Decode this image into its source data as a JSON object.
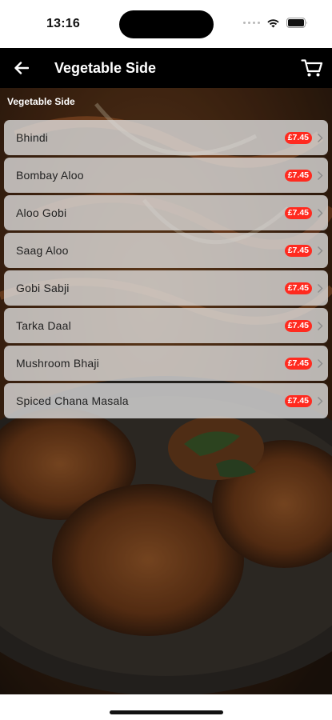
{
  "status_bar": {
    "time": "13:16",
    "icons": [
      "signal-dots-icon",
      "wifi-icon",
      "battery-icon"
    ]
  },
  "nav": {
    "title": "Vegetable Side",
    "back_icon": "arrow-left-icon",
    "cart_icon": "cart-icon"
  },
  "section": {
    "heading": "Vegetable Side"
  },
  "items": [
    {
      "name": "Bhindi",
      "price": "£7.45"
    },
    {
      "name": "Bombay Aloo",
      "price": "£7.45"
    },
    {
      "name": "Aloo Gobi",
      "price": "£7.45"
    },
    {
      "name": "Saag Aloo",
      "price": "£7.45"
    },
    {
      "name": "Gobi Sabji",
      "price": "£7.45"
    },
    {
      "name": "Tarka Daal",
      "price": "£7.45"
    },
    {
      "name": "Mushroom Bhaji",
      "price": "£7.45"
    },
    {
      "name": "Spiced Chana Masala",
      "price": "£7.45"
    }
  ],
  "colors": {
    "nav_background": "#000000",
    "price_badge": "#ff2a1f",
    "row_background": "#e1e1e1"
  }
}
